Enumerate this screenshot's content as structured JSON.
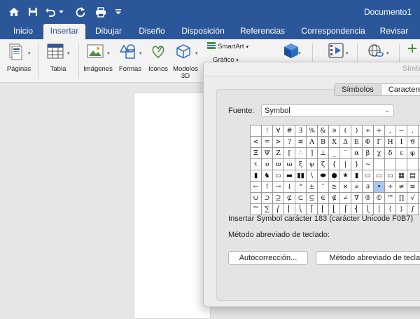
{
  "title_bar": {
    "document_title": "Documento1"
  },
  "tabs": [
    {
      "label": "Inicio"
    },
    {
      "label": "Insertar"
    },
    {
      "label": "Dibujar"
    },
    {
      "label": "Diseño"
    },
    {
      "label": "Disposición"
    },
    {
      "label": "Referencias"
    },
    {
      "label": "Correspondencia"
    },
    {
      "label": "Revisar"
    }
  ],
  "ribbon": {
    "paginas": "Páginas",
    "tabla": "Tabla",
    "imagenes": "Imágenes",
    "formas": "Formas",
    "iconos": "Iconos",
    "modelos_line1": "Modelos",
    "modelos_line2": "3D",
    "smartart": "SmartArt",
    "grafico": "Gráfico"
  },
  "dialog": {
    "title": "Símbolo",
    "segments": [
      "Símbolos",
      "Caracteres"
    ],
    "font_label": "Fuente:",
    "font_value": "Symbol",
    "insert_info": "Insertar Symbol carácter 183 (carácter Unicode F0B7)",
    "shortcut_label": "Método abreviado de teclado:",
    "autocorrect_button": "Autocorrección...",
    "shortcut_button": "Método abreviado de teclado...",
    "symbol_grid": [
      [
        " ",
        "!",
        "∀",
        "#",
        "∃",
        "%",
        "&",
        "∍",
        "(",
        ")",
        "∗",
        "+",
        ",",
        "−",
        ".",
        "/"
      ],
      [
        "<",
        "=",
        ">",
        "?",
        "≅",
        "Α",
        "Β",
        "Χ",
        "Δ",
        "Ε",
        "Φ",
        "Γ",
        "Η",
        "Ι",
        "ϑ",
        "Κ"
      ],
      [
        "Ξ",
        "Ψ",
        "Ζ",
        "[",
        "∴",
        "]",
        "⊥",
        "_",
        "‾",
        "α",
        "β",
        "χ",
        "δ",
        "ε",
        "φ",
        "γ"
      ],
      [
        "τ",
        "υ",
        "ϖ",
        "ω",
        "ξ",
        "ψ",
        "ζ",
        "{",
        "|",
        "}",
        "∼",
        " ",
        " ",
        " ",
        " ",
        " "
      ],
      [
        "▮",
        "♞",
        "▭",
        "▬",
        "▮▮",
        "\\",
        "⬬",
        "●",
        "★",
        "▮",
        "▭",
        "▭",
        "▭",
        "▦",
        "▤",
        "▯"
      ],
      [
        "←",
        "↑",
        "→",
        "↓",
        "°",
        "±",
        "″",
        "≥",
        "×",
        "∝",
        "∂",
        "•",
        "÷",
        "≠",
        "≡",
        "≈"
      ],
      [
        "∪",
        "⊃",
        "⊇",
        "⊄",
        "⊂",
        "⊆",
        "∈",
        "∉",
        "∠",
        "∇",
        "®",
        "©",
        "™",
        "∏",
        "√",
        "⋅"
      ],
      [
        "™",
        "∑",
        "⎛",
        "⎜",
        "⎝",
        "⎡",
        "⎢",
        "⎣",
        "⎧",
        "⎨",
        "⎩",
        "⎪",
        "⟨",
        "⟩",
        "∫",
        "⌠"
      ]
    ],
    "selected_cell": [
      5,
      11
    ]
  }
}
